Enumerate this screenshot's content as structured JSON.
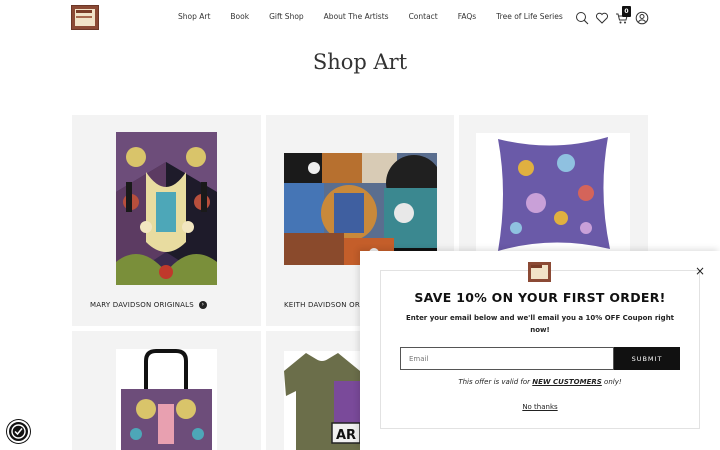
{
  "header": {
    "nav": [
      "Shop Art",
      "Book",
      "Gift Shop",
      "About The Artists",
      "Contact",
      "FAQs",
      "Tree of Life Series"
    ],
    "cart_count": "0",
    "icons": [
      "search-icon",
      "heart-icon",
      "cart-icon",
      "account-icon"
    ]
  },
  "page_title": "Shop Art",
  "cards": [
    {
      "label": "MARY DAVIDSON ORIGINALS"
    },
    {
      "label": "KEITH DAVIDSON ORIG"
    }
  ],
  "popup": {
    "heading": "SAVE 10% ON YOUR FIRST ORDER!",
    "subtext": "Enter your email below and we'll email you a 10% OFF Coupon right now!",
    "email_placeholder": "Email",
    "submit_label": "SUBMIT",
    "offer_prefix": "This offer is valid for ",
    "offer_emphasis": "NEW CUSTOMERS",
    "offer_suffix": " only!",
    "dismiss_label": "No thanks",
    "close_symbol": "×"
  },
  "colors": {
    "accent": "#111111",
    "card_bg": "#f3f3f3",
    "logo": "#8b4a35"
  }
}
